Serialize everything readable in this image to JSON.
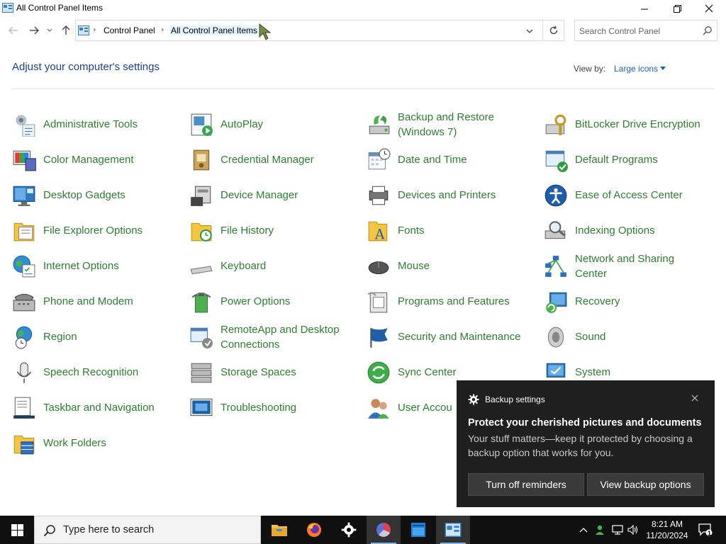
{
  "window": {
    "title": "All Control Panel Items"
  },
  "address": {
    "crumbs": [
      "Control Panel",
      "All Control Panel Items"
    ],
    "search_placeholder": "Search Control Panel"
  },
  "header": {
    "heading": "Adjust your computer's settings",
    "view_by_label": "View by:",
    "view_by_value": "Large icons"
  },
  "items": [
    {
      "label": "Administrative Tools",
      "icon": "admin-tools-icon"
    },
    {
      "label": "AutoPlay",
      "icon": "autoplay-icon"
    },
    {
      "label": "Backup and Restore (Windows 7)",
      "line1": "Backup and Restore",
      "line2": "(Windows 7)",
      "icon": "backup-icon"
    },
    {
      "label": "BitLocker Drive Encryption",
      "icon": "bitlocker-icon"
    },
    {
      "label": "Color Management",
      "icon": "color-management-icon"
    },
    {
      "label": "Credential Manager",
      "icon": "credential-manager-icon"
    },
    {
      "label": "Date and Time",
      "icon": "date-time-icon"
    },
    {
      "label": "Default Programs",
      "icon": "default-programs-icon"
    },
    {
      "label": "Desktop Gadgets",
      "icon": "desktop-gadgets-icon"
    },
    {
      "label": "Device Manager",
      "icon": "device-manager-icon"
    },
    {
      "label": "Devices and Printers",
      "icon": "devices-printers-icon"
    },
    {
      "label": "Ease of Access Center",
      "icon": "ease-of-access-icon"
    },
    {
      "label": "File Explorer Options",
      "icon": "file-explorer-options-icon"
    },
    {
      "label": "File History",
      "icon": "file-history-icon"
    },
    {
      "label": "Fonts",
      "icon": "fonts-icon"
    },
    {
      "label": "Indexing Options",
      "icon": "indexing-options-icon"
    },
    {
      "label": "Internet Options",
      "icon": "internet-options-icon"
    },
    {
      "label": "Keyboard",
      "icon": "keyboard-icon"
    },
    {
      "label": "Mouse",
      "icon": "mouse-icon"
    },
    {
      "label": "Network and Sharing Center",
      "line1": "Network and Sharing",
      "line2": "Center",
      "icon": "network-sharing-icon"
    },
    {
      "label": "Phone and Modem",
      "icon": "phone-modem-icon"
    },
    {
      "label": "Power Options",
      "icon": "power-options-icon"
    },
    {
      "label": "Programs and Features",
      "icon": "programs-features-icon"
    },
    {
      "label": "Recovery",
      "icon": "recovery-icon"
    },
    {
      "label": "Region",
      "icon": "region-icon"
    },
    {
      "label": "RemoteApp and Desktop Connections",
      "line1": "RemoteApp and Desktop",
      "line2": "Connections",
      "icon": "remoteapp-icon"
    },
    {
      "label": "Security and Maintenance",
      "icon": "security-maintenance-icon"
    },
    {
      "label": "Sound",
      "icon": "sound-icon"
    },
    {
      "label": "Speech Recognition",
      "icon": "speech-recognition-icon"
    },
    {
      "label": "Storage Spaces",
      "icon": "storage-spaces-icon"
    },
    {
      "label": "Sync Center",
      "icon": "sync-center-icon"
    },
    {
      "label": "System",
      "icon": "system-icon"
    },
    {
      "label": "Taskbar and Navigation",
      "icon": "taskbar-navigation-icon"
    },
    {
      "label": "Troubleshooting",
      "icon": "troubleshooting-icon"
    },
    {
      "label": "User Accou",
      "icon": "user-accounts-icon"
    },
    {
      "label": "",
      "icon": ""
    },
    {
      "label": "Work Folders",
      "icon": "work-folders-icon"
    }
  ],
  "toast": {
    "app": "Backup settings",
    "title": "Protect your cherished pictures and documents",
    "body": "Your stuff matters—keep it protected by choosing a backup option that works for you.",
    "button1": "Turn off reminders",
    "button2": "View backup options"
  },
  "taskbar": {
    "search_placeholder": "Type here to search",
    "time": "8:21 AM",
    "date": "11/20/2024",
    "notification_count": "1"
  },
  "colors": {
    "link_green": "#2e7d32",
    "heading_blue": "#1c3f94",
    "toast_bg": "#1f1f1f",
    "taskbar_bg": "#101010"
  }
}
